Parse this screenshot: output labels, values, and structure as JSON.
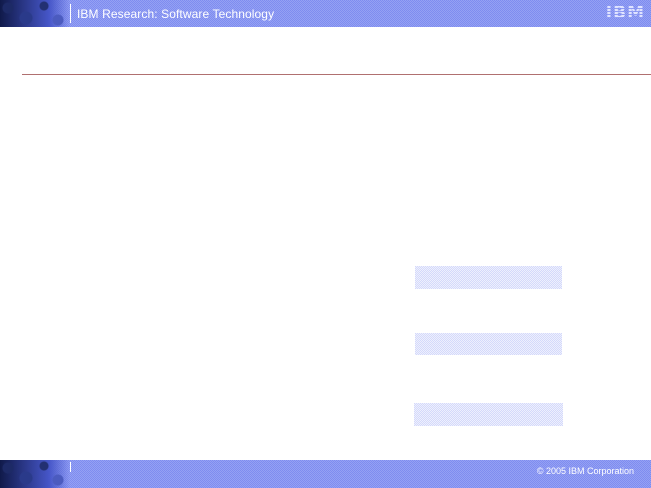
{
  "header": {
    "title": "IBM Research: Software Technology",
    "logo": "IBM"
  },
  "footer": {
    "copyright": "© 2005 IBM Corporation"
  },
  "colors": {
    "banner": "#7e8cf0",
    "rule": "#b07070",
    "placeholder_box": "#d4d9fb"
  }
}
